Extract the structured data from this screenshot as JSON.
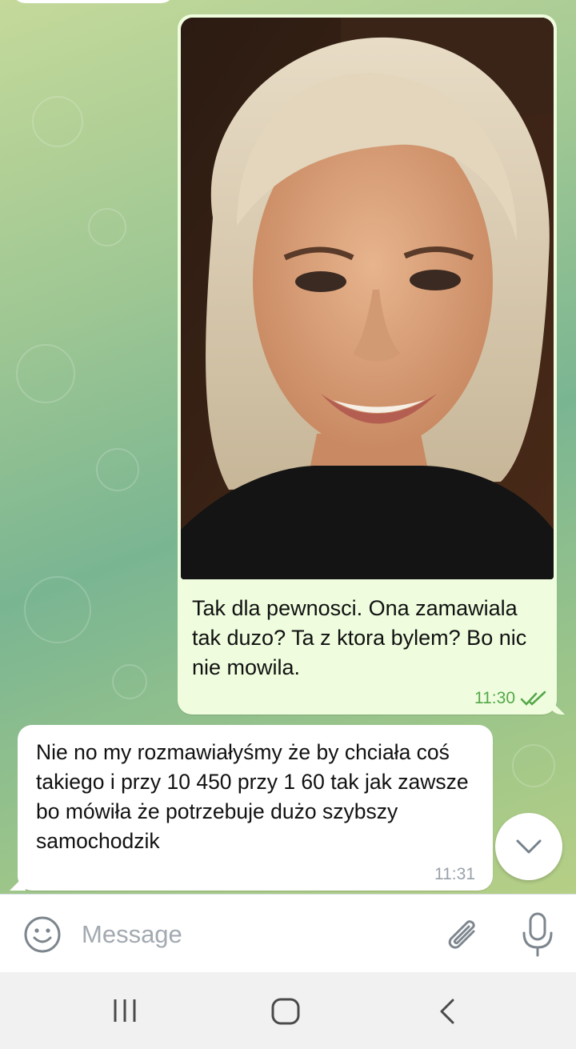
{
  "chat": {
    "outgoing": {
      "photo_alt": "photo",
      "text": "Tak dla pewnosci. Ona zamawiala tak duzo? Ta z ktora bylem? Bo nic nie mowila.",
      "time": "11:30",
      "status_icon": "double-check-icon"
    },
    "incoming": {
      "text": "Nie no my rozmawiałyśmy że by chciała coś takiego i przy 10 450 przy 1 60 tak jak zawsze bo mówiła że potrzebuje dużo szybszy samochodzik",
      "time": "11:31"
    },
    "scroll_button_icon": "chevron-down-icon"
  },
  "input_bar": {
    "placeholder": "Message",
    "emoji_icon": "smile-icon",
    "attach_icon": "paperclip-icon",
    "mic_icon": "microphone-icon"
  },
  "nav_bar": {
    "recents_icon": "recents-icon",
    "home_icon": "home-icon",
    "back_icon": "back-icon"
  },
  "colors": {
    "outgoing_bubble": "#effdde",
    "incoming_bubble": "#ffffff",
    "read_check": "#55a84a",
    "chat_background": "#9fc793"
  }
}
